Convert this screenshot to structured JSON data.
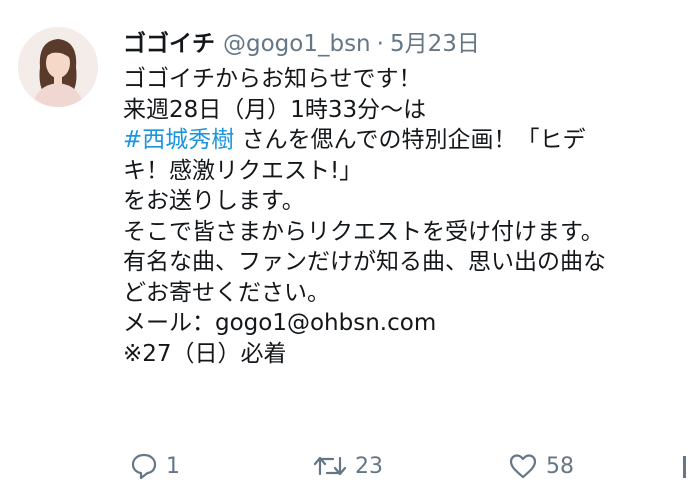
{
  "tweet": {
    "author": {
      "display_name": "ゴゴイチ",
      "handle": "@gogo1_bsn"
    },
    "separator": "·",
    "date": "5月23日",
    "lines": [
      "ゴゴイチからお知らせです！",
      "来週28日（月）1時33分～は",
      {
        "hashtag": "#西城秀樹",
        "rest": " さんを偲んでの特別企画！「ヒデ"
      },
      "キ！感激リクエスト!」",
      "をお送りします。",
      "そこで皆さまからリクエストを受け付けます。",
      "有名な曲、ファンだけが知る曲、思い出の曲な",
      "どお寄せください。",
      "メール：gogo1@ohbsn.com",
      "※27（日）必着"
    ],
    "actions": {
      "reply_count": "1",
      "retweet_count": "23",
      "like_count": "58"
    }
  },
  "colors": {
    "text": "#14171a",
    "secondary": "#657786",
    "hashtag": "#1b95e0"
  },
  "icons": {
    "reply": "reply-icon",
    "retweet": "retweet-icon",
    "like": "heart-icon"
  }
}
